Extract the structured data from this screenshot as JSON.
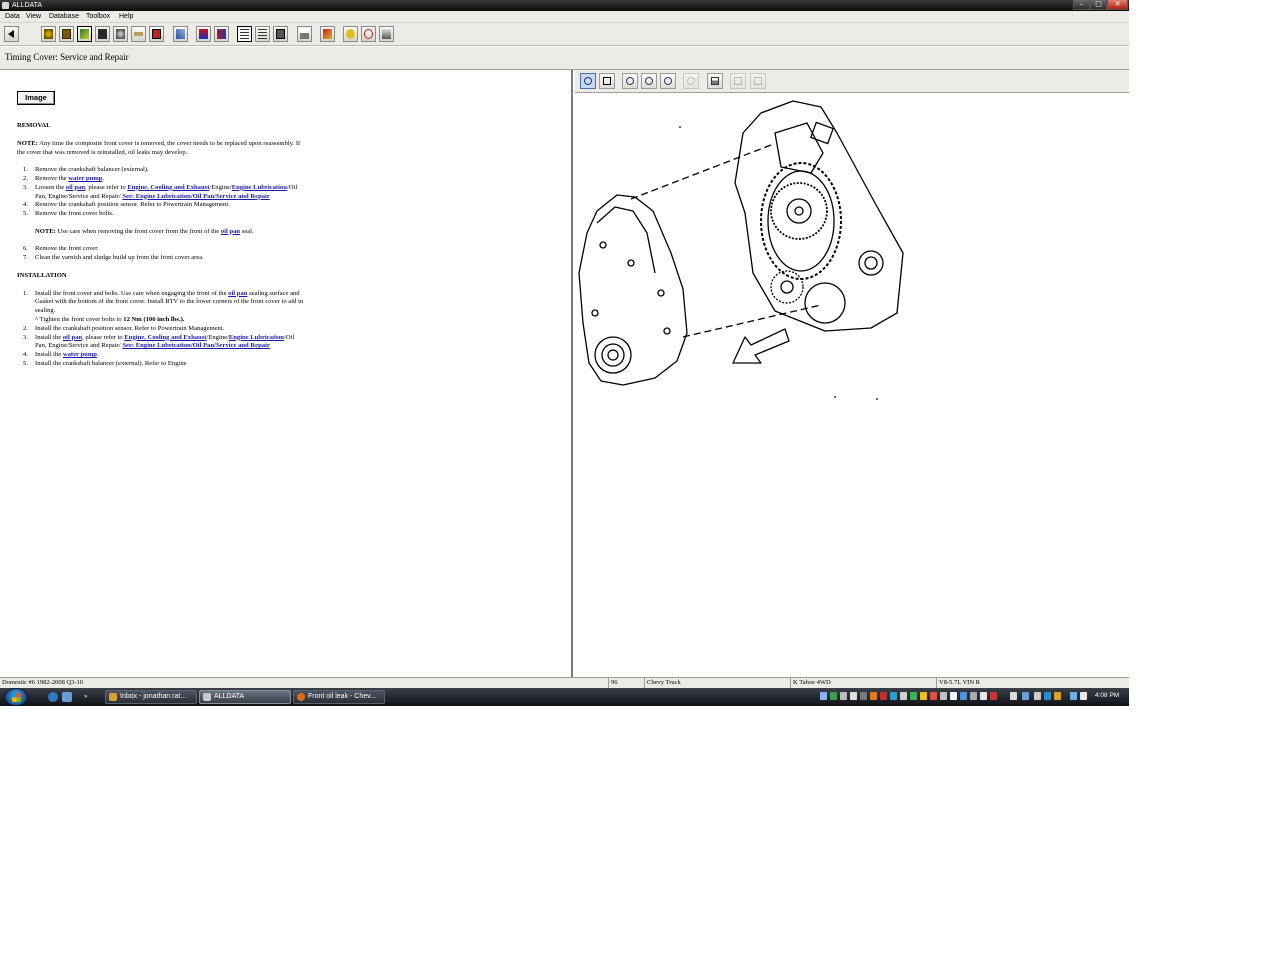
{
  "window": {
    "title": "ALLDATA"
  },
  "menu": [
    "Data",
    "View",
    "Database",
    "Toolbox",
    "Help"
  ],
  "document": {
    "title": "Timing Cover:  Service and Repair",
    "image_button": "Image",
    "removal": {
      "heading": "REMOVAL",
      "note_label": "NOTE:",
      "note_text": "  Any time the composite front cover is removed, the cover needs to be replaced upon reassembly.  If the cover that was removed is reinstalled, oil leaks may develop.",
      "step1": "Remove the crankshaft balancer (external).",
      "step2_pre": "Remove the ",
      "step2_link": "water pump",
      "step2_post": ".",
      "step3_pre": "Loosen the ",
      "step3_link1": "oil pan",
      "step3_mid1": ", please refer to ",
      "step3_link2": "Engine, Cooling and Exhaust",
      "step3_mid2": "/Engine/",
      "step3_link3": "Engine Lubrication",
      "step3_mid3": "/Oil Pan, Engine/Service and Repair/ ",
      "step3_link4": "See: Engine Lubrication/Oil Pan/Service and Repair",
      "step4": "Remove the crankshaft position sensor. Refer to Powertrain Management.",
      "step5": "Remove the front cover bolts.",
      "note2_label": "NOTE:",
      "note2_pre": "  Use care when removing the front cover from the front of the ",
      "note2_link": "oil pan",
      "note2_post": " seal.",
      "step6": "Remove the front cover.",
      "step7": "Clean the varnish and sludge build up from the front cover area."
    },
    "installation": {
      "heading": "INSTALLATION",
      "step1_pre": "Install the front cover and bolts. Use care when engaging the front of the ",
      "step1_link": "oil pan",
      "step1_post": " sealing surface and Gasket with the bottom of the front cover. Install RTV to the lower corners of the front cover to aid in sealing.",
      "tighten_pre": "^  Tighten the front cover bolts to ",
      "tighten_value": "12 Nm (106 inch lbs.).",
      "step2": "Install the crankshaft position sensor. Refer to Powertrain Management.",
      "step3_pre": "Install the ",
      "step3_link1": "oil pan",
      "step3_mid1": ", please refer to ",
      "step3_link2": "Engine, Cooling and Exhaust",
      "step3_mid2": "/Engine/",
      "step3_link3": "Engine Lubrication",
      "step3_mid3": "/Oil Pan, Engine/Service and Repair/ ",
      "step3_link4": "See: Engine Lubrication/Oil Pan/Service and Repair",
      "step4_pre": "Install the ",
      "step4_link": "water pump",
      "step4_post": ".",
      "step5": "Install the crankshaft balancer (external). Refer to Engine"
    }
  },
  "status": {
    "database": "Domestic #6 1982-2008 Q3-10",
    "year": "96",
    "make": "Chevy Truck",
    "model": "K Tahoe 4WD",
    "engine": "V8-5.7L VIN R"
  },
  "taskbar": {
    "tasks": [
      "Inbox - jonathan.rat...",
      "ALLDATA",
      "Front oil leak - Chev..."
    ],
    "clock": "4:08 PM"
  },
  "colors": {
    "link": "#1a1aa6",
    "chrome": "#ecebe6"
  }
}
